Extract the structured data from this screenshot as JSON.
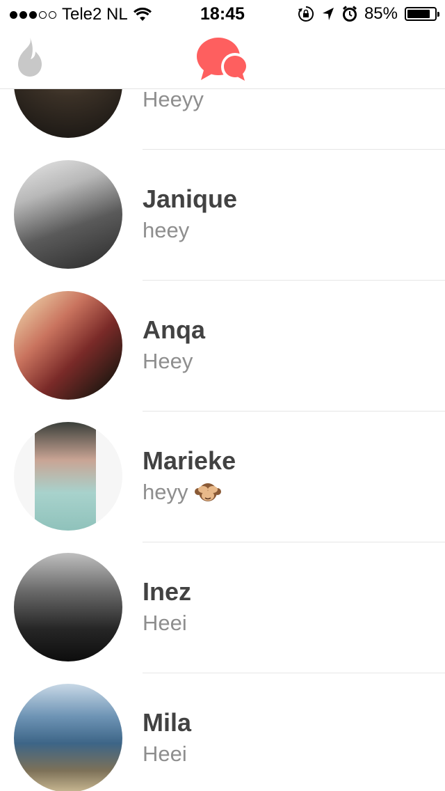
{
  "status_bar": {
    "carrier": "Tele2 NL",
    "time": "18:45",
    "battery": "85%",
    "battery_level": 0.85,
    "signal_bars_filled": 3,
    "signal_bars_total": 5,
    "icons": [
      "wifi-icon",
      "orientation-lock-icon",
      "location-arrow-icon",
      "alarm-clock-icon",
      "battery-icon"
    ]
  },
  "nav": {
    "left_icon": "flame-icon",
    "center_icon": "chat-bubbles-icon",
    "accent_color": "#fe5f5f",
    "inactive_color": "#c8c8c8"
  },
  "matches": [
    {
      "name": "",
      "preview": "Heeyy"
    },
    {
      "name": "Janique",
      "preview": "heey"
    },
    {
      "name": "Anqa",
      "preview": "Heey"
    },
    {
      "name": "Marieke",
      "preview": "heyy",
      "preview_emoji": "see-no-evil-monkey-icon"
    },
    {
      "name": "Inez",
      "preview": "Heei"
    },
    {
      "name": "Mila",
      "preview": "Heei"
    }
  ]
}
